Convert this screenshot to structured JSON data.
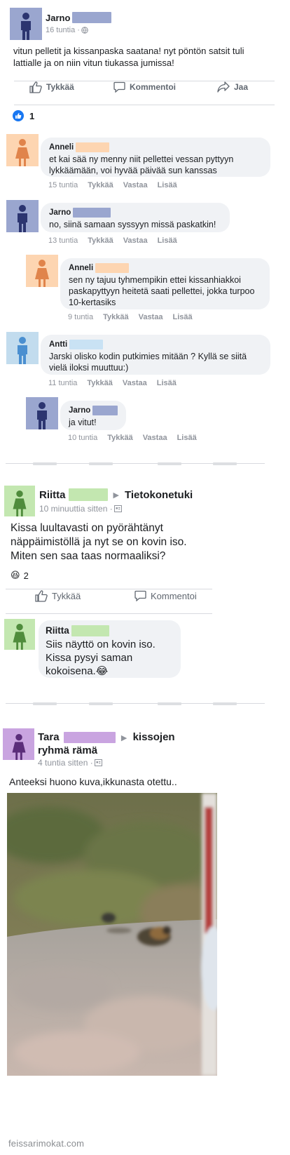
{
  "colors": {
    "male_avatar": "#9aa6cf",
    "female_avatar": "#fdd5b1",
    "blue_avatar": "#c2dcee",
    "green_avatar": "#c3e7b0",
    "purple_avatar": "#c9a4e0",
    "redact_blue": "#9aa6cf",
    "redact_peach": "#fdd5b1",
    "redact_lightblue": "#c9e2f4",
    "redact_green": "#c3e7b0",
    "redact_purple": "#c9a4e0",
    "like_blue": "#1877f2"
  },
  "post1": {
    "author": "Jarno",
    "meta": "16 tuntia · ",
    "meta_icon": "globe-icon",
    "text": "vitun pelletit ja kissanpaska saatana! nyt pöntön satsit tuli lattialle ja on niin vitun tiukassa jumissa!",
    "actions": {
      "like": "Tykkää",
      "comment": "Kommentoi",
      "share": "Jaa"
    },
    "reaction_count": "1",
    "comments": [
      {
        "author": "Anneli",
        "text": "et kai sää ny menny niit pellettei vessan pyttyyn lykkäämään, voi hyvää päivää sun kanssas",
        "time": "15 tuntia",
        "like": "Tykkää",
        "reply": "Vastaa",
        "more": "Lisää"
      },
      {
        "author": "Jarno",
        "text": "no, siinä samaan syssyyn missä paskatkin!",
        "time": "13 tuntia",
        "like": "Tykkää",
        "reply": "Vastaa",
        "more": "Lisää"
      },
      {
        "author": "Anneli",
        "text": "sen ny tajuu tyhmempikin ettei kissanhiakkoi paskapyttyyn heitetä saati pellettei, jokka turpoo 10-kertasiks",
        "time": "9 tuntia",
        "like": "Tykkää",
        "reply": "Vastaa",
        "more": "Lisää"
      },
      {
        "author": "Antti",
        "text": "Jarski olisko kodin putkimies mitään ? Kyllä se siitä vielä iloksi muuttuu:)",
        "time": "11 tuntia",
        "like": "Tykkää",
        "reply": "Vastaa",
        "more": "Lisää"
      },
      {
        "author": "Jarno",
        "text": "ja vitut!",
        "time": "10 tuntia",
        "like": "Tykkää",
        "reply": "Vastaa",
        "more": "Lisää"
      }
    ]
  },
  "post2": {
    "author": "Riitta",
    "group": "Tietokonetuki",
    "meta": "10 minuuttia sitten · ",
    "text": "Kissa luultavasti on pyörähtänyt näppäimistöllä ja nyt se on kovin iso. Miten sen saa taas normaaliksi?",
    "reaction_emoji": "😆",
    "reaction_count": "2",
    "actions": {
      "like": "Tykkää",
      "comment": "Kommentoi"
    },
    "comment": {
      "author": "Riitta",
      "text": "Siis näyttö on kovin iso. Kissa pysyi saman kokoisena.😂"
    }
  },
  "post3": {
    "author": "Tara",
    "group": "kissojen ryhmä rämä",
    "meta": "4 tuntia sitten · ",
    "text": "Anteeksi huono kuva,ikkunasta otettu..",
    "image_description": "blurry photo of a cat on a gravel road"
  },
  "watermark": "feissarimokat.com"
}
